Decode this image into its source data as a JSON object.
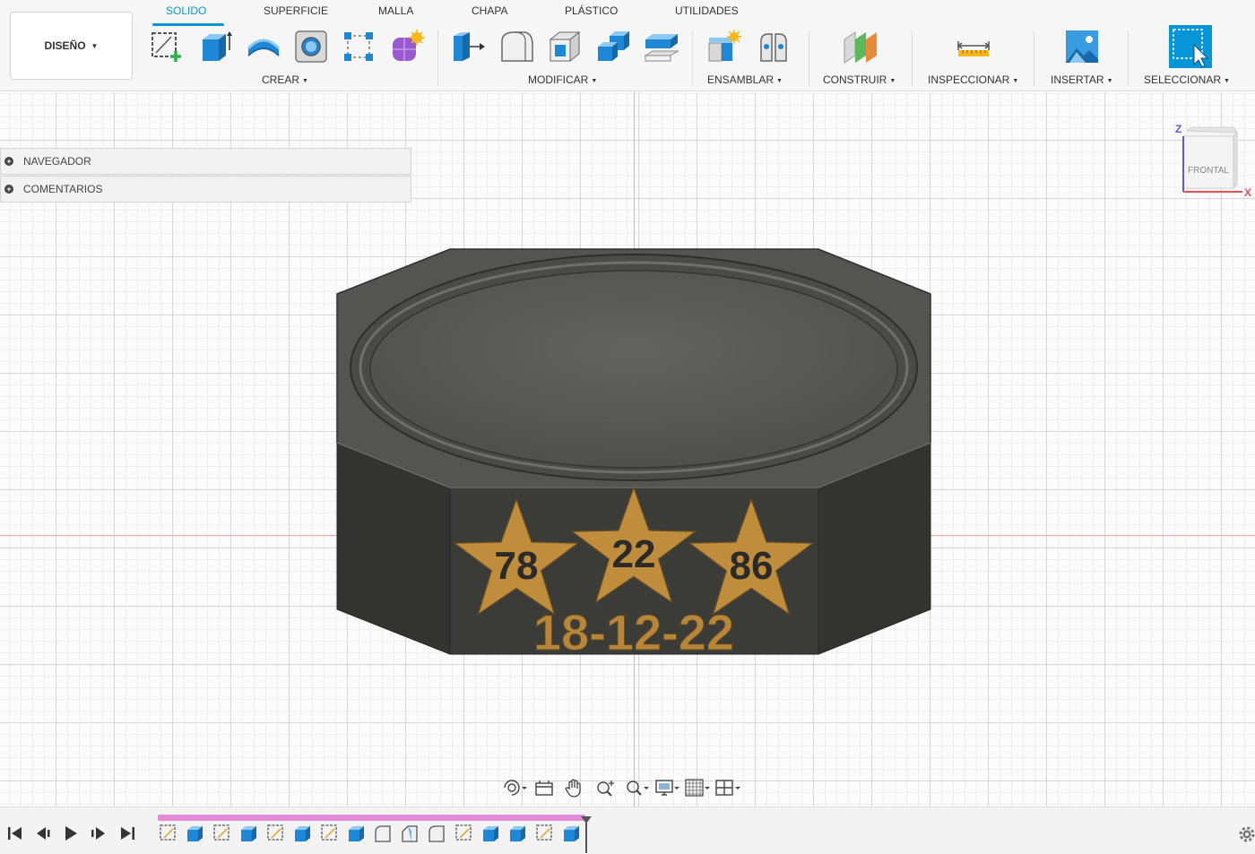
{
  "workspace": {
    "label": "DISEÑO"
  },
  "tabs": [
    {
      "label": "SOLIDO",
      "active": true
    },
    {
      "label": "SUPERFICIE",
      "active": false
    },
    {
      "label": "MALLA",
      "active": false
    },
    {
      "label": "CHAPA",
      "active": false
    },
    {
      "label": "PLÁSTICO",
      "active": false
    },
    {
      "label": "UTILIDADES",
      "active": false
    }
  ],
  "groups": {
    "crear": "CREAR",
    "modificar": "MODIFICAR",
    "ensamblar": "ENSAMBLAR",
    "construir": "CONSTRUIR",
    "inspeccionar": "INSPECCIONAR",
    "insertar": "INSERTAR",
    "seleccionar": "SELECCIONAR"
  },
  "tools": {
    "crear": [
      "create-sketch-icon",
      "extrude-icon",
      "revolve-icon",
      "hole-icon",
      "pattern-icon",
      "create-form-icon"
    ],
    "modificar": [
      "press-pull-icon",
      "fillet-icon",
      "shell-icon",
      "combine-icon",
      "offset-face-icon"
    ],
    "ensamblar": [
      "new-component-icon",
      "joint-icon"
    ],
    "construir": [
      "offset-plane-icon"
    ],
    "inspeccionar": [
      "measure-icon"
    ],
    "insertar": [
      "insert-image-icon"
    ],
    "seleccionar": [
      "select-icon"
    ]
  },
  "browser": {
    "navigator": "NAVEGADOR",
    "comments": "COMENTARIOS"
  },
  "viewcube": {
    "face": "FRONTAL",
    "axis_z": "Z",
    "axis_x": "X"
  },
  "model": {
    "stars": [
      "78",
      "22",
      "86"
    ],
    "date": "18-12-22",
    "colors": {
      "body": "#3b3b38",
      "top": "#555552",
      "emboss": "#c08d3c",
      "text_dark": "#2a2a28"
    }
  },
  "navbar": [
    "orbit-icon",
    "look-at-icon",
    "pan-icon",
    "zoom-icon",
    "fit-icon",
    "display-settings-icon",
    "grid-settings-icon",
    "viewports-icon"
  ],
  "timeline": {
    "features": [
      "sketch",
      "extrude",
      "sketch",
      "extrude",
      "sketch",
      "extrude",
      "sketch",
      "extrude",
      "fillet",
      "chamfer",
      "fillet",
      "sketch",
      "extrude",
      "extrude",
      "sketch",
      "extrude"
    ]
  },
  "colors": {
    "accent": "#0696d7",
    "timeline_bar": "#e38bd9"
  }
}
